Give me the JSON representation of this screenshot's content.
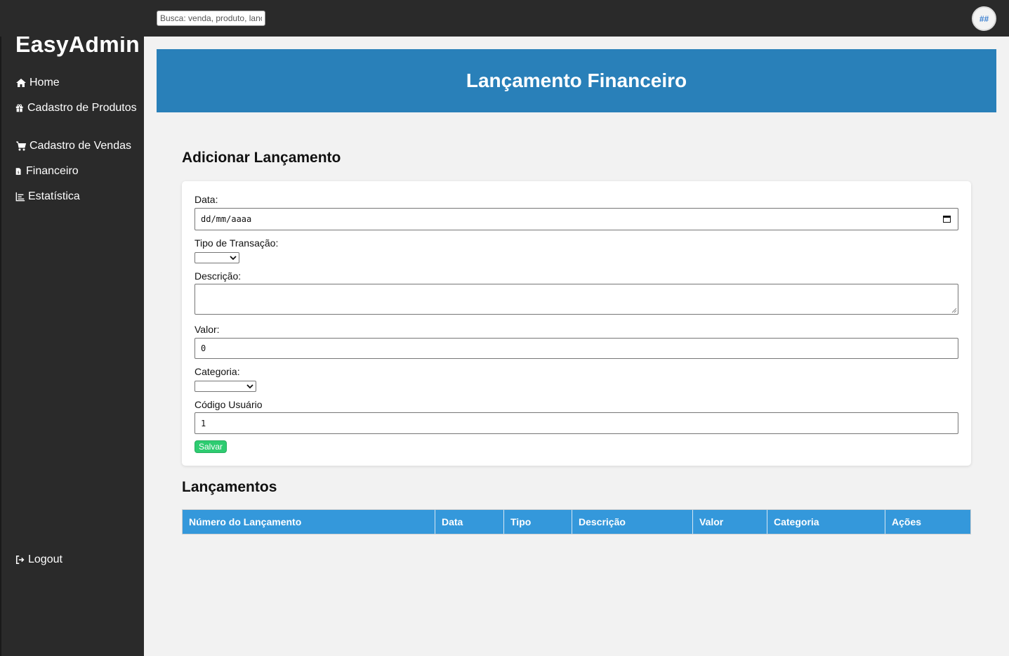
{
  "topbar": {
    "search_placeholder": "Busca: venda, produto, lançamento",
    "avatar_text": "##"
  },
  "sidebar": {
    "brand": "EasyAdmin",
    "items": [
      {
        "label": "Home",
        "icon": "home-icon"
      },
      {
        "label": "Cadastro de Produtos",
        "icon": "gift-icon"
      },
      {
        "label": "Cadastro de Vendas",
        "icon": "cart-icon"
      },
      {
        "label": "Financeiro",
        "icon": "file-invoice-dollar-icon"
      },
      {
        "label": "Estatística",
        "icon": "chart-line-icon"
      }
    ],
    "logout": {
      "label": "Logout",
      "icon": "sign-out-icon"
    }
  },
  "header": {
    "title": "Lançamento Financeiro"
  },
  "form": {
    "title": "Adicionar Lançamento",
    "data_label": "Data:",
    "data_value": "dd/mm/aaaa",
    "tipo_label": "Tipo de Transação:",
    "tipo_value": "",
    "descricao_label": "Descrição:",
    "descricao_value": "",
    "valor_label": "Valor:",
    "valor_value": "0",
    "categoria_label": "Categoria:",
    "categoria_value": "",
    "codigo_label": "Código Usuário",
    "codigo_value": "1",
    "save_label": "Salvar"
  },
  "list": {
    "title": "Lançamentos",
    "columns": [
      "Número do Lançamento",
      "Data",
      "Tipo",
      "Descrição",
      "Valor",
      "Categoria",
      "Ações"
    ],
    "rows": []
  },
  "colors": {
    "sidebar_bg": "#2a2a2a",
    "header_bg": "#2980b9",
    "table_header_bg": "#3498db",
    "save_button": "#2ecc71"
  }
}
